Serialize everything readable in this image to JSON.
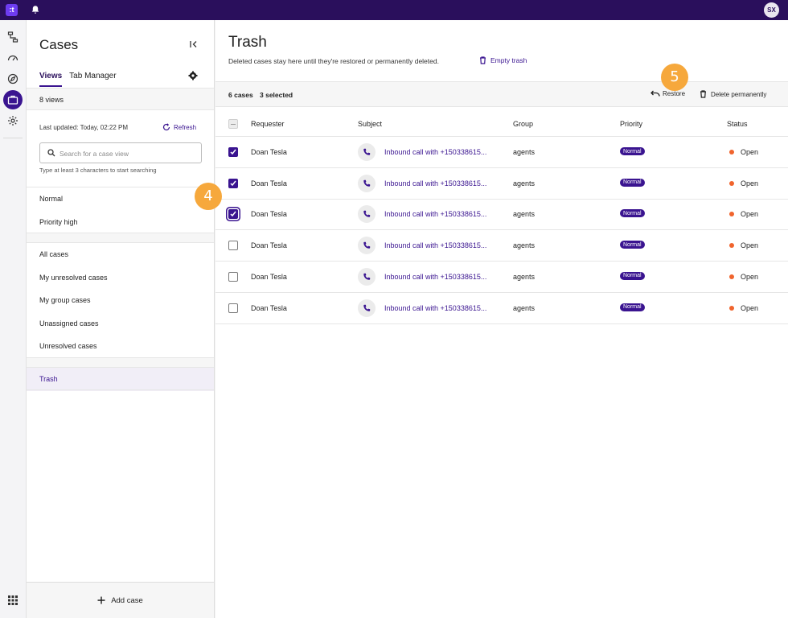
{
  "topbar": {
    "logo": ":t",
    "avatar": "SX"
  },
  "rail": {
    "icons": [
      "flow-icon",
      "dashboard-icon",
      "compass-icon",
      "briefcase-icon",
      "settings-icon"
    ],
    "bottom_icon": "apps-grid-icon"
  },
  "sidebar": {
    "title": "Cases",
    "tabs": [
      {
        "label": "Views"
      },
      {
        "label": "Tab Manager"
      }
    ],
    "views_count": "8 views",
    "last_updated": "Last updated:  Today, 02:22 PM",
    "refresh": "Refresh",
    "search": {
      "placeholder": "Search for a case view",
      "hint": "Type at least 3 characters to start searching"
    },
    "groups": [
      [
        "Normal",
        "Priority high"
      ],
      [
        "All cases",
        "My unresolved cases",
        "My group cases",
        "Unassigned cases",
        "Unresolved cases"
      ],
      [
        "Trash"
      ]
    ],
    "add_case": "Add case"
  },
  "main": {
    "title": "Trash",
    "subtitle": "Deleted cases stay here until they're restored or permanently deleted.",
    "empty_trash": "Empty trash",
    "toolbar": {
      "count": "6 cases",
      "selected": "3 selected",
      "restore": "Restore",
      "delete": "Delete permanently"
    },
    "columns": [
      "Requester",
      "Subject",
      "Group",
      "Priority",
      "Status"
    ],
    "rows": [
      {
        "checked": true,
        "requester": "Doan Tesla",
        "subject": "Inbound call with +150338615...",
        "group": "agents",
        "priority": "Normal",
        "status": "Open"
      },
      {
        "checked": true,
        "requester": "Doan Tesla",
        "subject": "Inbound call with +150338615...",
        "group": "agents",
        "priority": "Normal",
        "status": "Open"
      },
      {
        "checked": true,
        "requester": "Doan Tesla",
        "subject": "Inbound call with +150338615...",
        "group": "agents",
        "priority": "Normal",
        "status": "Open"
      },
      {
        "checked": false,
        "requester": "Doan Tesla",
        "subject": "Inbound call with +150338615...",
        "group": "agents",
        "priority": "Normal",
        "status": "Open"
      },
      {
        "checked": false,
        "requester": "Doan Tesla",
        "subject": "Inbound call with +150338615...",
        "group": "agents",
        "priority": "Normal",
        "status": "Open"
      },
      {
        "checked": false,
        "requester": "Doan Tesla",
        "subject": "Inbound call with +150338615...",
        "group": "agents",
        "priority": "Normal",
        "status": "Open"
      }
    ]
  },
  "steps": [
    "4",
    "5"
  ],
  "colors": {
    "brand": "#2a0f5c",
    "accent": "#3a1490",
    "step": "#f6a83c",
    "status_open": "#f0642d"
  }
}
